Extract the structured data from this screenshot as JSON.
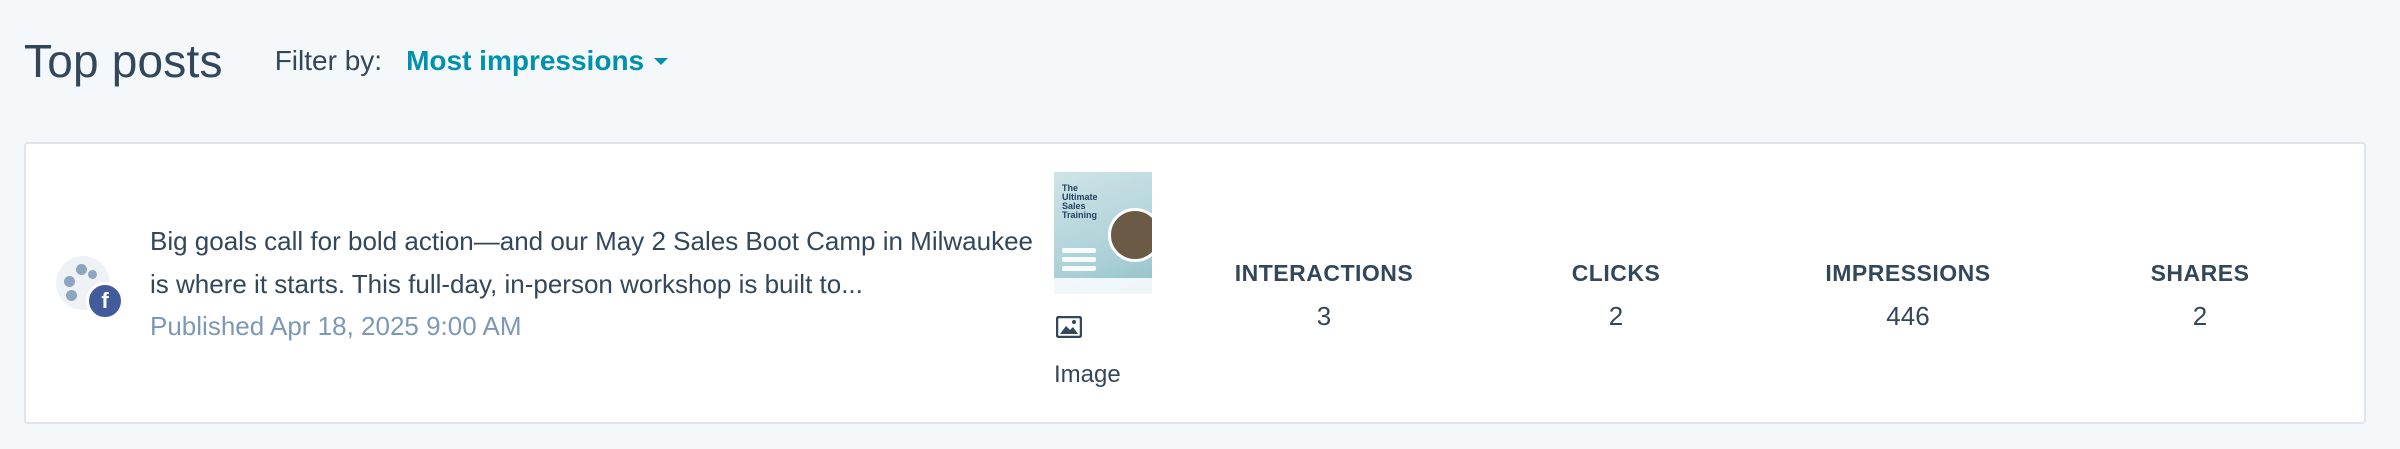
{
  "header": {
    "title": "Top posts",
    "filter_label": "Filter by:",
    "filter_value": "Most impressions"
  },
  "post": {
    "network": "facebook",
    "network_badge": "f",
    "body": "Big goals call for bold action—and our May 2 Sales Boot Camp in Milwaukee is where it starts. This full-day, in-person workshop is built to...",
    "published": "Published Apr 18, 2025 9:00 AM",
    "media": {
      "thumbnail_title": "The Ultimate Sales Training",
      "icon": "image-icon",
      "type_label": "Image"
    },
    "metrics": [
      {
        "label": "INTERACTIONS",
        "value": "3"
      },
      {
        "label": "CLICKS",
        "value": "2"
      },
      {
        "label": "IMPRESSIONS",
        "value": "446"
      },
      {
        "label": "SHARES",
        "value": "2"
      }
    ]
  },
  "colors": {
    "accent": "#0091ae",
    "text": "#33475b",
    "muted": "#7c98b6",
    "facebook": "#425b9b"
  }
}
